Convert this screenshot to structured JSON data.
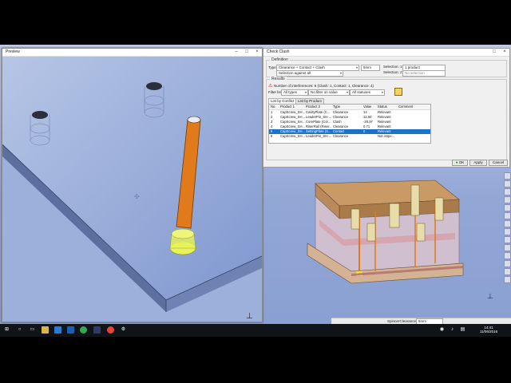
{
  "preview": {
    "title": "Preview"
  },
  "clash": {
    "title": "Check Clash",
    "definition_label": "Definition",
    "type_label": "Type:",
    "type_value": "Clearance + Contact + Clash",
    "clearance_value": "5mm",
    "selection_mode": "Selection against all",
    "selection1_label": "Selection: 1",
    "selection1_value": "1 product",
    "selection2_label": "Selection: 2",
    "selection2_value": "No selection",
    "results_label": "Results",
    "results_summary": "Number of interferences: 6 (Clash: 1, Contact: 1, Clearance: 4)",
    "filter_label": "Filter list:",
    "filter1": "All types",
    "filter2": "No filter on value",
    "filter3": "All statuses",
    "tabs": [
      "List by Conflict",
      "List by Product"
    ],
    "columns": [
      "No.",
      "Product 1",
      "Product 2",
      "Type",
      "Value",
      "Status",
      "Comment"
    ],
    "rows": [
      {
        "no": "1",
        "p1": "CapScrew_SH...",
        "p2": "CavityPlate (C...",
        "type": "Clearance",
        "value": "14",
        "status": "Relevant",
        "comment": ""
      },
      {
        "no": "2",
        "p1": "CapScrew_SH...",
        "p2": "LeaderPin_SH-...",
        "type": "Clearance",
        "value": "12.94",
        "status": "Relevant",
        "comment": ""
      },
      {
        "no": "3",
        "p1": "CapScrew_SH...",
        "p2": "CorePlate (Cor...",
        "type": "Clash",
        "value": "-20.97",
        "status": "Relevant",
        "comment": ""
      },
      {
        "no": "4",
        "p1": "CapScrew_SH...",
        "p2": "RiserRail (Riser...",
        "type": "Clearance",
        "value": "0.71",
        "status": "Relevant",
        "comment": ""
      },
      {
        "no": "5",
        "p1": "CapScrew_SH...",
        "p2": "SettingPlate (S...",
        "type": "Contact",
        "value": "0",
        "status": "Relevant",
        "comment": ""
      },
      {
        "no": "6",
        "p1": "CapScrew_SH...",
        "p2": "LeaderPin_SH-...",
        "type": "Clearance",
        "value": "",
        "status": "Not inspe...",
        "comment": ""
      }
    ],
    "ok": "OK",
    "apply": "Apply",
    "cancel": "Cancel"
  },
  "statusbar": {
    "label": "SpinnerClearance",
    "value": "5mm"
  },
  "taskbar": {
    "time": "14:41",
    "date": "11/06/2016"
  },
  "icons": [
    "windows-start-icon",
    "search-icon",
    "task-view-icon",
    "folder-icon",
    "store-icon",
    "outlook-icon",
    "chrome-icon",
    "catia-icon",
    "chrome-icon-2",
    "settings-icon"
  ],
  "colors": {
    "selection": "#1a73c8",
    "pin": "#e07a1a",
    "workspace": "#93a7d6"
  }
}
